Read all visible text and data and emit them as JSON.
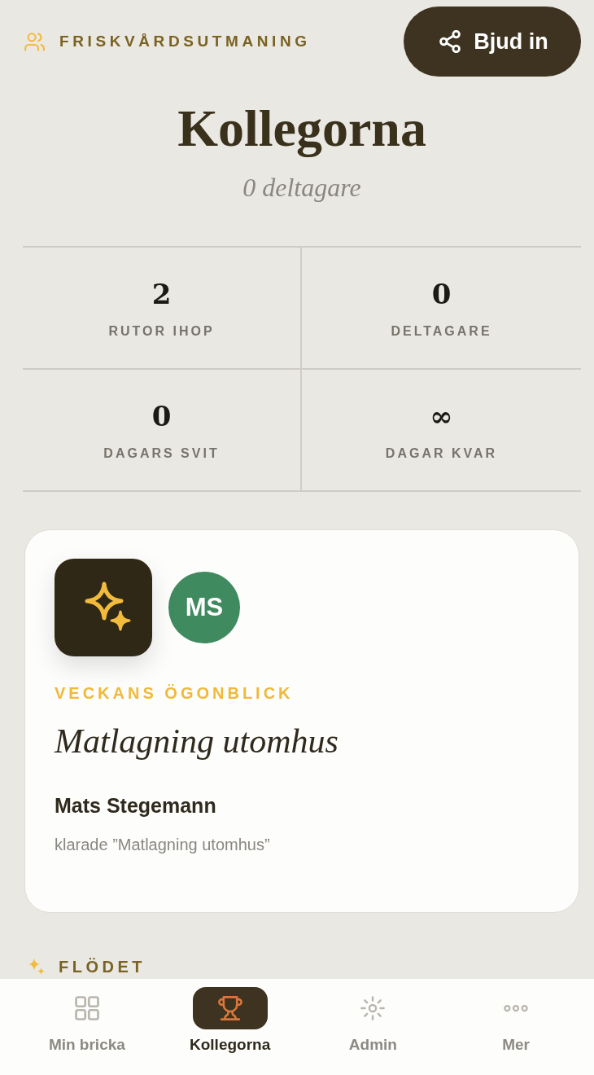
{
  "header": {
    "eyebrow": "FRISKVÅRDSUTMANING",
    "invite_button": "Bjud in"
  },
  "title": "Kollegorna",
  "subtitle": "0 deltagare",
  "stats": [
    {
      "value": "2",
      "label": "RUTOR IHOP"
    },
    {
      "value": "0",
      "label": "DELTAGARE"
    },
    {
      "value": "0",
      "label": "DAGARS SVIT"
    },
    {
      "value": "∞",
      "label": "DAGAR KVAR"
    }
  ],
  "moment_card": {
    "eyebrow": "VECKANS ÖGONBLICK",
    "avatar_initials": "MS",
    "title": "Matlagning utomhus",
    "person": "Mats Stegemann",
    "activity": "klarade ”Matlagning utomhus”"
  },
  "feed": {
    "heading": "FLÖDET"
  },
  "bottom_nav": [
    {
      "label": "Min bricka",
      "selected": false
    },
    {
      "label": "Kollegorna",
      "selected": true
    },
    {
      "label": "Admin",
      "selected": false
    },
    {
      "label": "Mer",
      "selected": false
    }
  ]
}
